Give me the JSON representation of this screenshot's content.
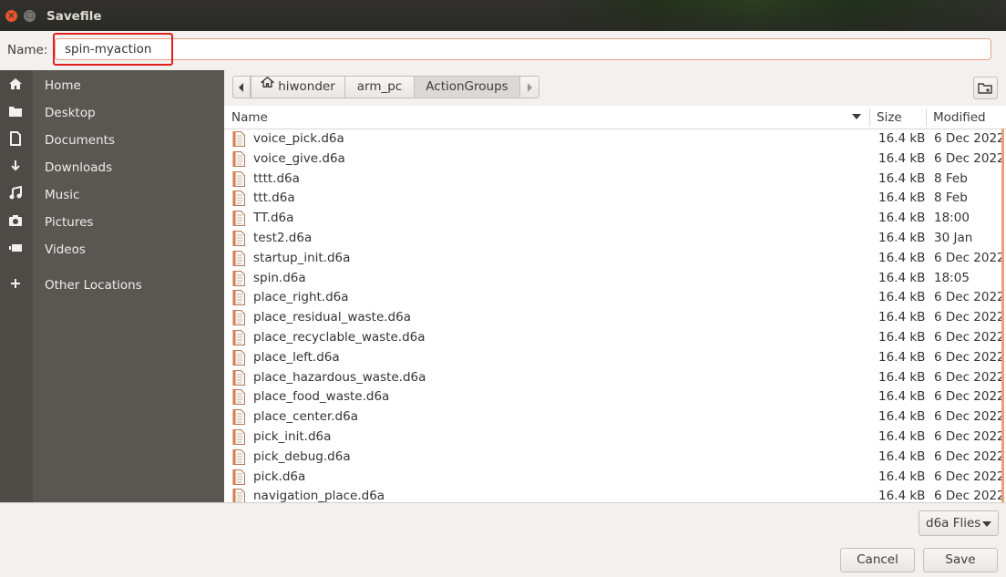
{
  "window": {
    "title": "Savefile"
  },
  "name_row": {
    "label": "Name:",
    "value": "spin-myaction"
  },
  "sidebar": {
    "items": [
      {
        "label": "Home",
        "icon": "home-icon"
      },
      {
        "label": "Desktop",
        "icon": "folder-icon"
      },
      {
        "label": "Documents",
        "icon": "document-icon"
      },
      {
        "label": "Downloads",
        "icon": "download-icon"
      },
      {
        "label": "Music",
        "icon": "music-icon"
      },
      {
        "label": "Pictures",
        "icon": "camera-icon"
      },
      {
        "label": "Videos",
        "icon": "video-icon"
      },
      {
        "label": "Other Locations",
        "icon": "plus-icon"
      }
    ]
  },
  "pathbar": {
    "segments": [
      "hiwonder",
      "arm_pc",
      "ActionGroups"
    ]
  },
  "columns": {
    "name": "Name",
    "size": "Size",
    "modified": "Modified"
  },
  "files": [
    {
      "name": "voice_pick.d6a",
      "size": "16.4 kB",
      "modified": "6 Dec 2022"
    },
    {
      "name": "voice_give.d6a",
      "size": "16.4 kB",
      "modified": "6 Dec 2022"
    },
    {
      "name": "tttt.d6a",
      "size": "16.4 kB",
      "modified": "8 Feb"
    },
    {
      "name": "ttt.d6a",
      "size": "16.4 kB",
      "modified": "8 Feb"
    },
    {
      "name": "TT.d6a",
      "size": "16.4 kB",
      "modified": "18:00"
    },
    {
      "name": "test2.d6a",
      "size": "16.4 kB",
      "modified": "30 Jan"
    },
    {
      "name": "startup_init.d6a",
      "size": "16.4 kB",
      "modified": "6 Dec 2022"
    },
    {
      "name": "spin.d6a",
      "size": "16.4 kB",
      "modified": "18:05"
    },
    {
      "name": "place_right.d6a",
      "size": "16.4 kB",
      "modified": "6 Dec 2022"
    },
    {
      "name": "place_residual_waste.d6a",
      "size": "16.4 kB",
      "modified": "6 Dec 2022"
    },
    {
      "name": "place_recyclable_waste.d6a",
      "size": "16.4 kB",
      "modified": "6 Dec 2022"
    },
    {
      "name": "place_left.d6a",
      "size": "16.4 kB",
      "modified": "6 Dec 2022"
    },
    {
      "name": "place_hazardous_waste.d6a",
      "size": "16.4 kB",
      "modified": "6 Dec 2022"
    },
    {
      "name": "place_food_waste.d6a",
      "size": "16.4 kB",
      "modified": "6 Dec 2022"
    },
    {
      "name": "place_center.d6a",
      "size": "16.4 kB",
      "modified": "6 Dec 2022"
    },
    {
      "name": "pick_init.d6a",
      "size": "16.4 kB",
      "modified": "6 Dec 2022"
    },
    {
      "name": "pick_debug.d6a",
      "size": "16.4 kB",
      "modified": "6 Dec 2022"
    },
    {
      "name": "pick.d6a",
      "size": "16.4 kB",
      "modified": "6 Dec 2022"
    },
    {
      "name": "navigation_place.d6a",
      "size": "16.4 kB",
      "modified": "6 Dec 2022"
    }
  ],
  "filter": {
    "label": "d6a Flies"
  },
  "buttons": {
    "cancel": "Cancel",
    "save": "Save"
  },
  "colors": {
    "accent": "#e95420",
    "highlight_box": "#e02020",
    "sidebar_bg": "#5a5752"
  }
}
